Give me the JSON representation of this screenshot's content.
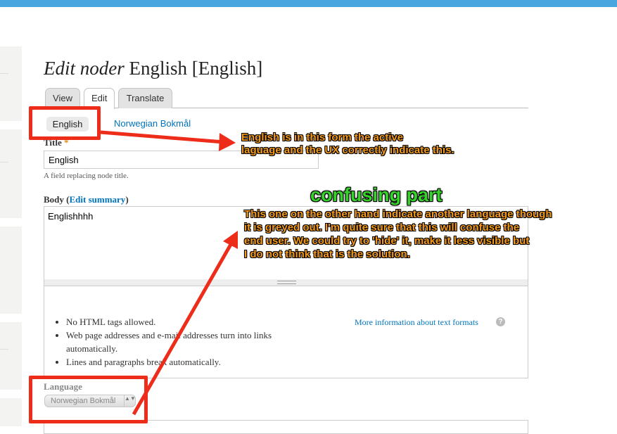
{
  "page": {
    "title_prefix": "Edit noder",
    "title_rest": " English [English]"
  },
  "tabs": [
    {
      "label": "View",
      "active": false
    },
    {
      "label": "Edit",
      "active": true
    },
    {
      "label": "Translate",
      "active": false
    }
  ],
  "language_tabs": {
    "active": "English",
    "other": "Norwegian Bokmål"
  },
  "form": {
    "title_label": "Title",
    "required_mark": "*",
    "title_value": "English",
    "title_description": "A field replacing node title.",
    "body_label": "Body",
    "edit_summary_link": "Edit summary",
    "body_value": "Englishhhh",
    "format_tips": [
      "No HTML tags allowed.",
      "Web page addresses and e-mail addresses turn into links automatically.",
      "Lines and paragraphs break automatically."
    ],
    "more_info_link": "More information about text formats",
    "help_icon_glyph": "?",
    "language_label": "Language",
    "language_value": "Norwegian Bokmål",
    "select_arrows": "▲▼"
  },
  "annotations": {
    "note1_line1": "English is in this form the active",
    "note1_line2": "laguage and the UX correctly indicate this.",
    "heading": "confusing part",
    "note2_line1": "This one on the other hand indicate another language though",
    "note2_line2": "it is greyed out. I'm quite sure that this will confuse the",
    "note2_line3": "end user. We could try to 'hide' it, make it less visible but",
    "note2_line4": "I do not think that is the solution."
  },
  "colors": {
    "accent_bar": "#4aa6de",
    "link": "#0074bd",
    "highlight": "#ee2c1a",
    "annotation_text": "#f59a1b",
    "annotation_heading": "#35d22a"
  }
}
